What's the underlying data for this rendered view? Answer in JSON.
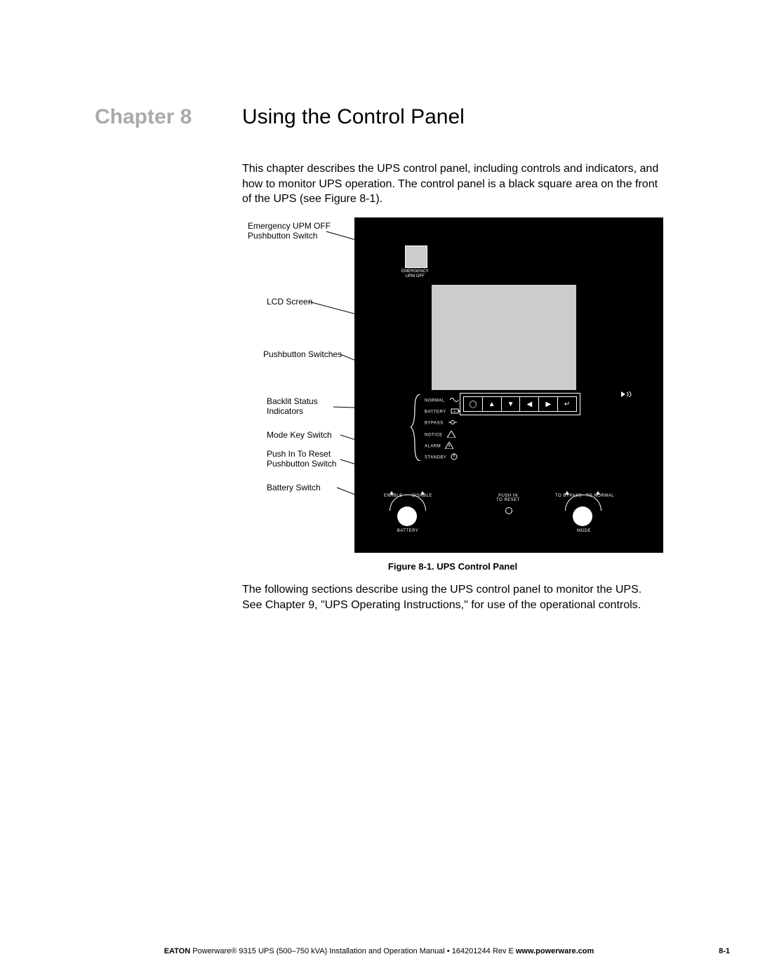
{
  "chapter_label": "Chapter 8",
  "chapter_title": "Using the Control Panel",
  "intro_text": "This chapter describes the UPS control panel, including controls and indicators, and how to monitor UPS operation. The control panel is a black square area on the front of the UPS (see Figure 8-1).",
  "callouts": {
    "emergency_l1": "Emergency UPM OFF",
    "emergency_l2": "Pushbutton Switch",
    "lcd": "LCD Screen",
    "pbswitches": "Pushbutton Switches",
    "status_l1": "Backlit Status",
    "status_l2": "Indicators",
    "mode_key": "Mode Key Switch",
    "reset_l1": "Push In To Reset",
    "reset_l2": "Pushbutton Switch",
    "battery": "Battery Switch"
  },
  "panel": {
    "emergency_l1": "EMERGENCY",
    "emergency_l2": "UPM  OFF",
    "status": {
      "normal": "NORMAL",
      "battery": "BATTERY",
      "bypass": "BYPASS",
      "notice": "NOTICE",
      "alarm": "ALARM",
      "standby": "STANDBY"
    },
    "pushbuttons": [
      "◯",
      "▲",
      "▼",
      "◀",
      "▶",
      "↵"
    ],
    "battery": {
      "enable": "ENABLE",
      "disable": "DISABLE",
      "label": "BATTERY"
    },
    "reset": {
      "l1": "PUSH  IN",
      "l2": "TO  RESET"
    },
    "mode": {
      "to_bypass": "TO  BYPASS",
      "to_normal": "TO  NORMAL",
      "label": "MODE"
    }
  },
  "figure_caption": "Figure 8-1. UPS Control Panel",
  "body2": "The following sections describe using the UPS control panel to monitor the UPS. See Chapter 9, \"UPS Operating Instructions,\" for use of the operational controls.",
  "footer": {
    "brand": "EATON",
    "text": " Powerware® 9315 UPS (500–750 kVA) Installation and Operation Manual  •  164201244 Rev E ",
    "url": "www.powerware.com",
    "pagenum": "8-1"
  }
}
